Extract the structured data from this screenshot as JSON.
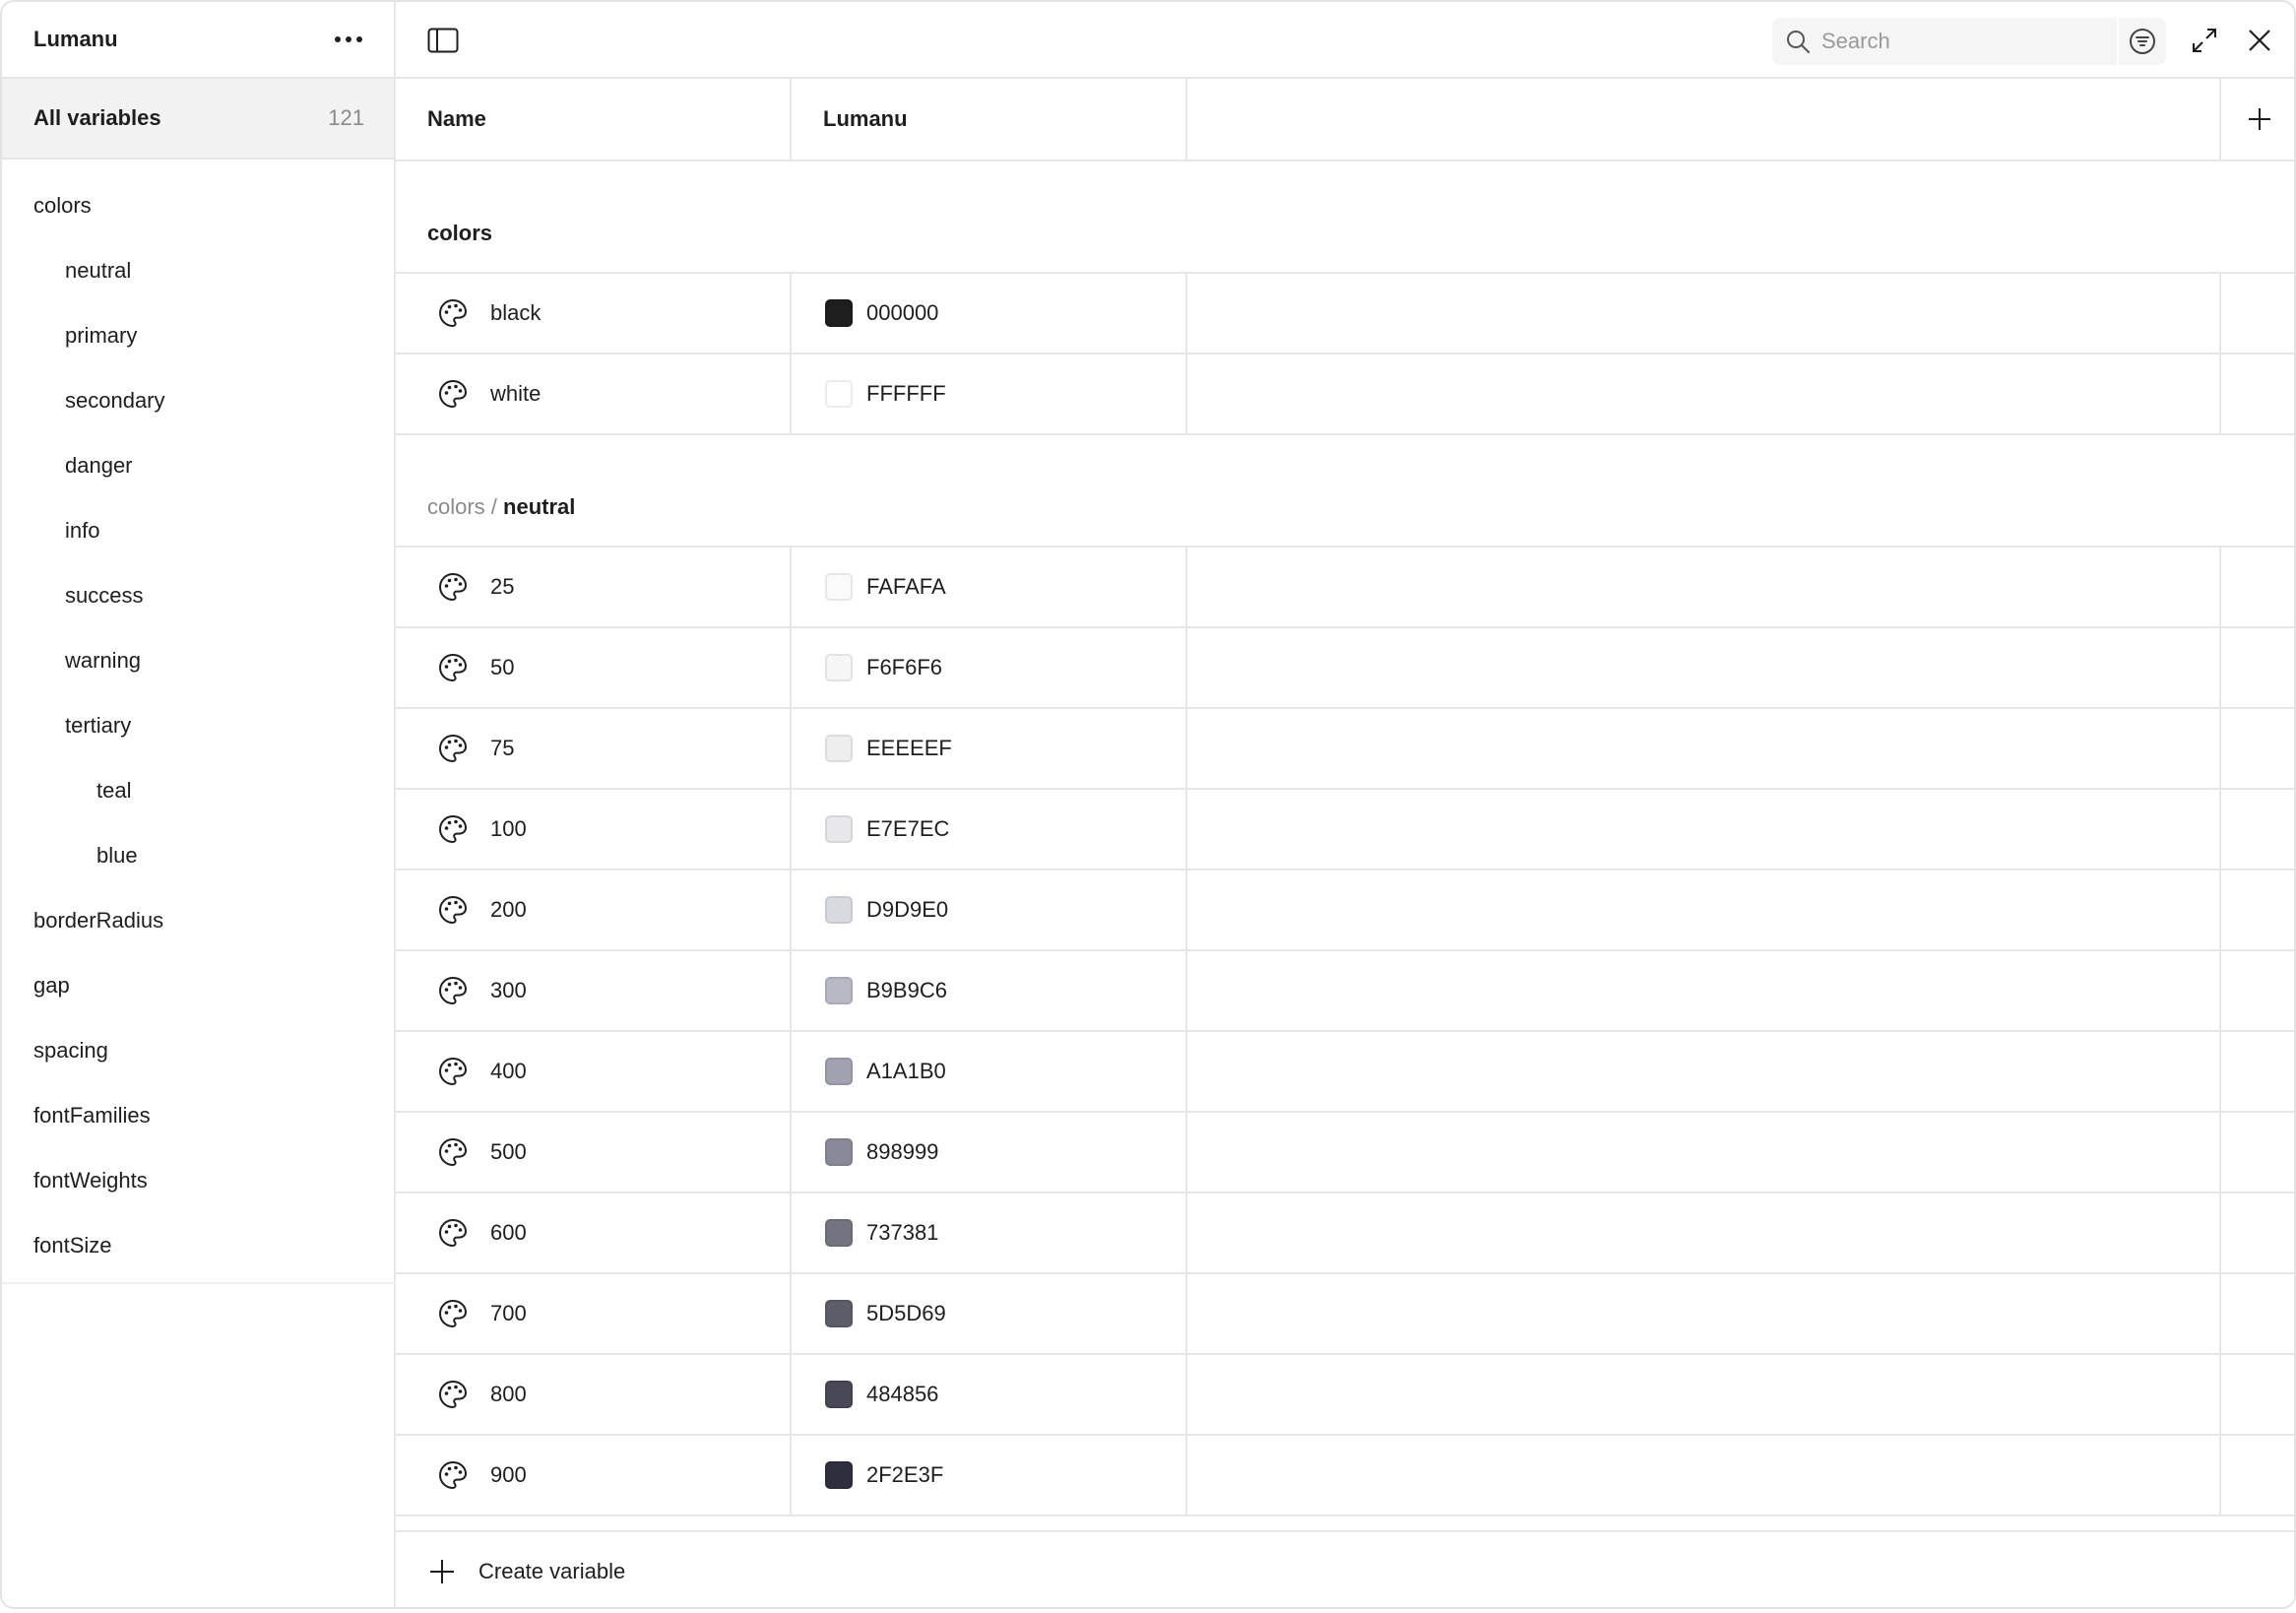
{
  "sidebar": {
    "title": "Lumanu",
    "all_variables": {
      "label": "All variables",
      "count": "121"
    },
    "groups": [
      {
        "label": "colors",
        "level": 0
      },
      {
        "label": "neutral",
        "level": 1
      },
      {
        "label": "primary",
        "level": 1
      },
      {
        "label": "secondary",
        "level": 1
      },
      {
        "label": "danger",
        "level": 1
      },
      {
        "label": "info",
        "level": 1
      },
      {
        "label": "success",
        "level": 1
      },
      {
        "label": "warning",
        "level": 1
      },
      {
        "label": "tertiary",
        "level": 1
      },
      {
        "label": "teal",
        "level": 2
      },
      {
        "label": "blue",
        "level": 2
      },
      {
        "label": "borderRadius",
        "level": 0
      },
      {
        "label": "gap",
        "level": 0
      },
      {
        "label": "spacing",
        "level": 0
      },
      {
        "label": "fontFamilies",
        "level": 0
      },
      {
        "label": "fontWeights",
        "level": 0
      },
      {
        "label": "fontSize",
        "level": 0
      }
    ]
  },
  "toolbar": {
    "search_placeholder": "Search"
  },
  "table": {
    "columns": {
      "name": "Name",
      "mode": "Lumanu"
    },
    "sections": [
      {
        "path": "",
        "name": "colors",
        "rows": [
          {
            "name": "black",
            "value": "000000",
            "color": "#1e1e1e"
          },
          {
            "name": "white",
            "value": "FFFFFF",
            "color": "#ffffff"
          }
        ]
      },
      {
        "path": "colors / ",
        "name": "neutral",
        "rows": [
          {
            "name": "25",
            "value": "FAFAFA",
            "color": "#FAFAFA"
          },
          {
            "name": "50",
            "value": "F6F6F6",
            "color": "#F6F6F6"
          },
          {
            "name": "75",
            "value": "EEEEEF",
            "color": "#EEEEEF"
          },
          {
            "name": "100",
            "value": "E7E7EC",
            "color": "#E7E7EC"
          },
          {
            "name": "200",
            "value": "D9D9E0",
            "color": "#D9D9E0"
          },
          {
            "name": "300",
            "value": "B9B9C6",
            "color": "#B9B9C6"
          },
          {
            "name": "400",
            "value": "A1A1B0",
            "color": "#A1A1B0"
          },
          {
            "name": "500",
            "value": "898999",
            "color": "#898999"
          },
          {
            "name": "600",
            "value": "737381",
            "color": "#737381"
          },
          {
            "name": "700",
            "value": "5D5D69",
            "color": "#5D5D69"
          },
          {
            "name": "800",
            "value": "484856",
            "color": "#484856"
          },
          {
            "name": "900",
            "value": "2F2E3F",
            "color": "#2F2E3F"
          }
        ]
      }
    ]
  },
  "footer": {
    "create_label": "Create variable"
  }
}
